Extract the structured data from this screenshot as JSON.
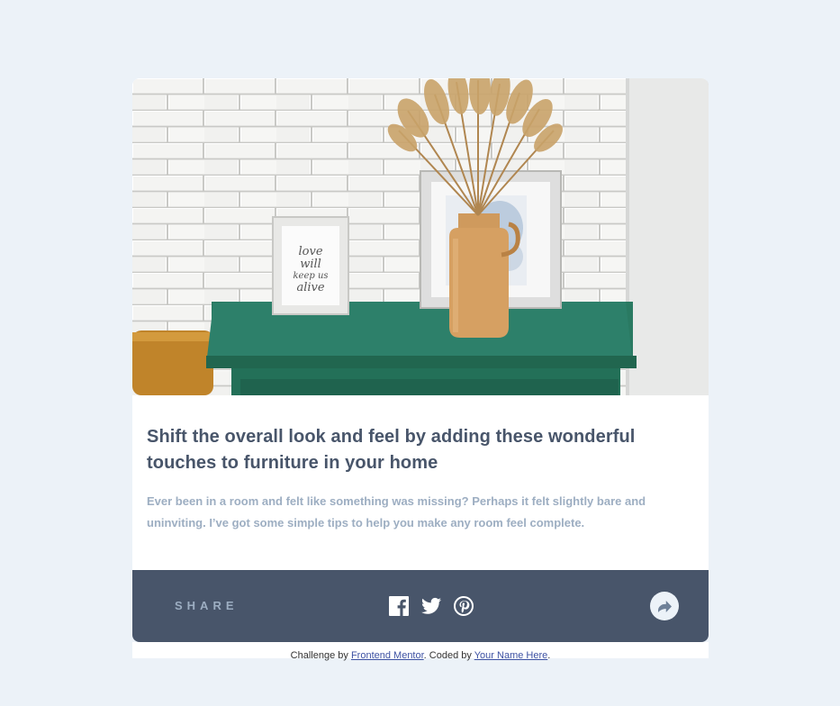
{
  "article": {
    "image_text": "love will keep us alive",
    "title": "Shift the overall look and feel by adding these wonderful touches to furniture in your home",
    "description": "Ever been in a room and felt like something was missing? Perhaps it felt slightly bare and uninviting. I’ve got some simple tips to help you make any room feel complete."
  },
  "share": {
    "label": "SHARE",
    "icons": [
      "facebook-icon",
      "twitter-icon",
      "pinterest-icon",
      "share-arrow-icon"
    ]
  },
  "attribution": {
    "prefix": "Challenge by ",
    "link1": "Frontend Mentor",
    "middle": ". Coded by ",
    "link2": "Your Name Here",
    "suffix": "."
  },
  "colors": {
    "background": "#ecf2f8",
    "title": "#48556a",
    "text": "#9daec2",
    "bar": "#48556a",
    "link": "#3e52a3"
  }
}
